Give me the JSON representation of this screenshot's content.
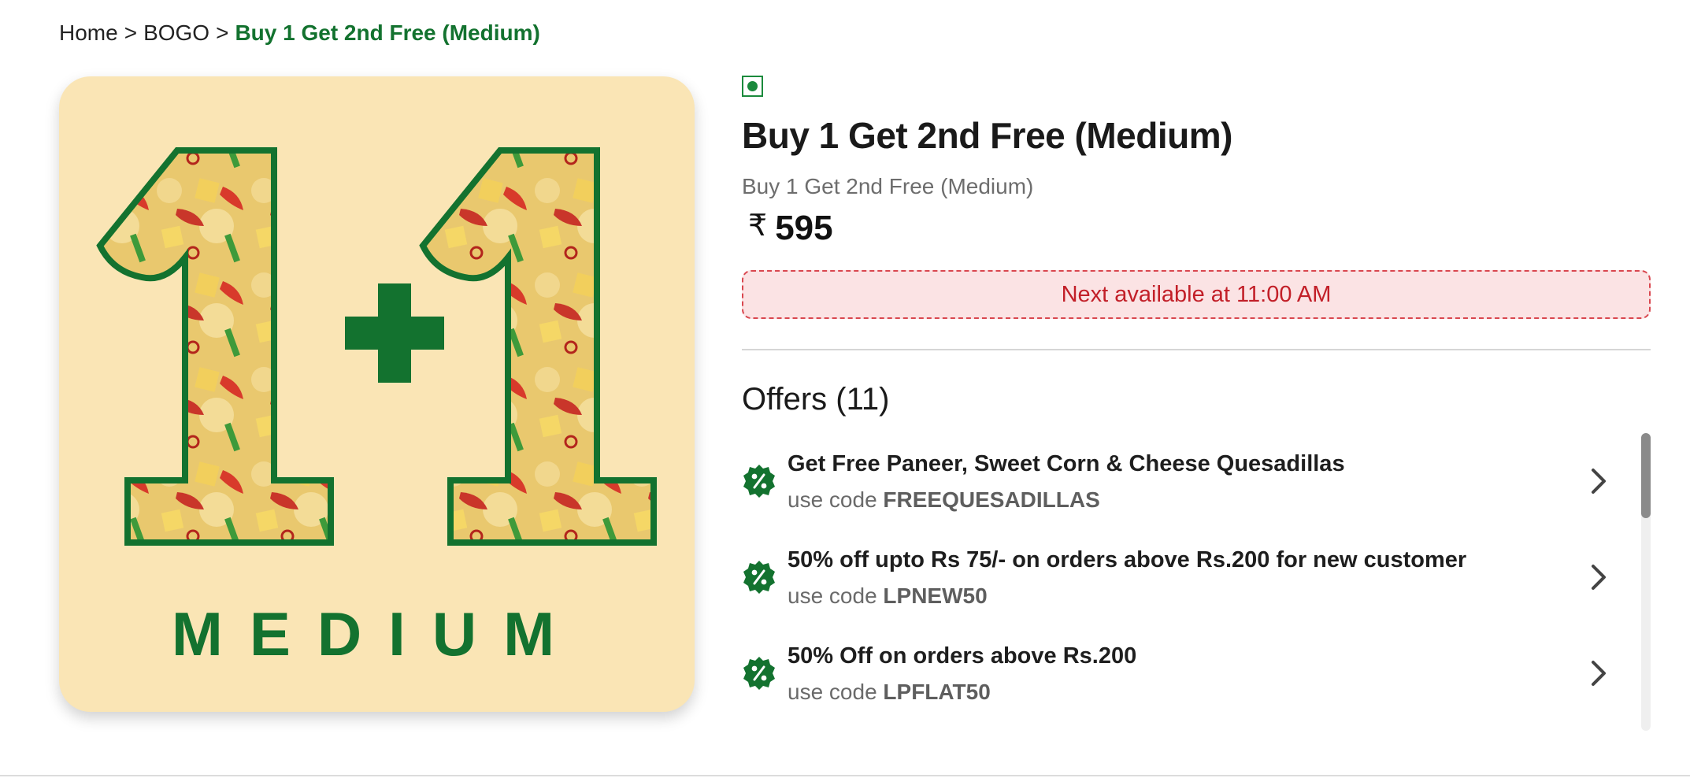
{
  "breadcrumb": {
    "items": [
      "Home",
      "BOGO"
    ],
    "separator": ">",
    "current": "Buy 1 Get 2nd Free (Medium)"
  },
  "product": {
    "image": {
      "big_text": "1+1",
      "size_label": "MEDIUM",
      "background_color": "#fae5b5",
      "accent_color": "#13722f"
    },
    "veg_icon": "veg-indicator-icon",
    "title": "Buy 1 Get 2nd Free (Medium)",
    "subtitle": "Buy 1 Get 2nd Free (Medium)",
    "currency_symbol": "₹",
    "price": "595",
    "availability": "Next available at 11:00 AM"
  },
  "offers": {
    "title": "Offers (11)",
    "code_prefix": "use code",
    "items": [
      {
        "title": "Get Free Paneer, Sweet Corn & Cheese Quesadillas",
        "code": "FREEQUESADILLAS"
      },
      {
        "title": "50% off upto Rs 75/- on orders above Rs.200 for new customer",
        "code": "LPNEW50"
      },
      {
        "title": "50% Off on orders above Rs.200",
        "code": "LPFLAT50"
      }
    ]
  },
  "colors": {
    "brand_green": "#13722f",
    "alert_red": "#c21f28",
    "alert_bg": "#fbe3e4"
  }
}
